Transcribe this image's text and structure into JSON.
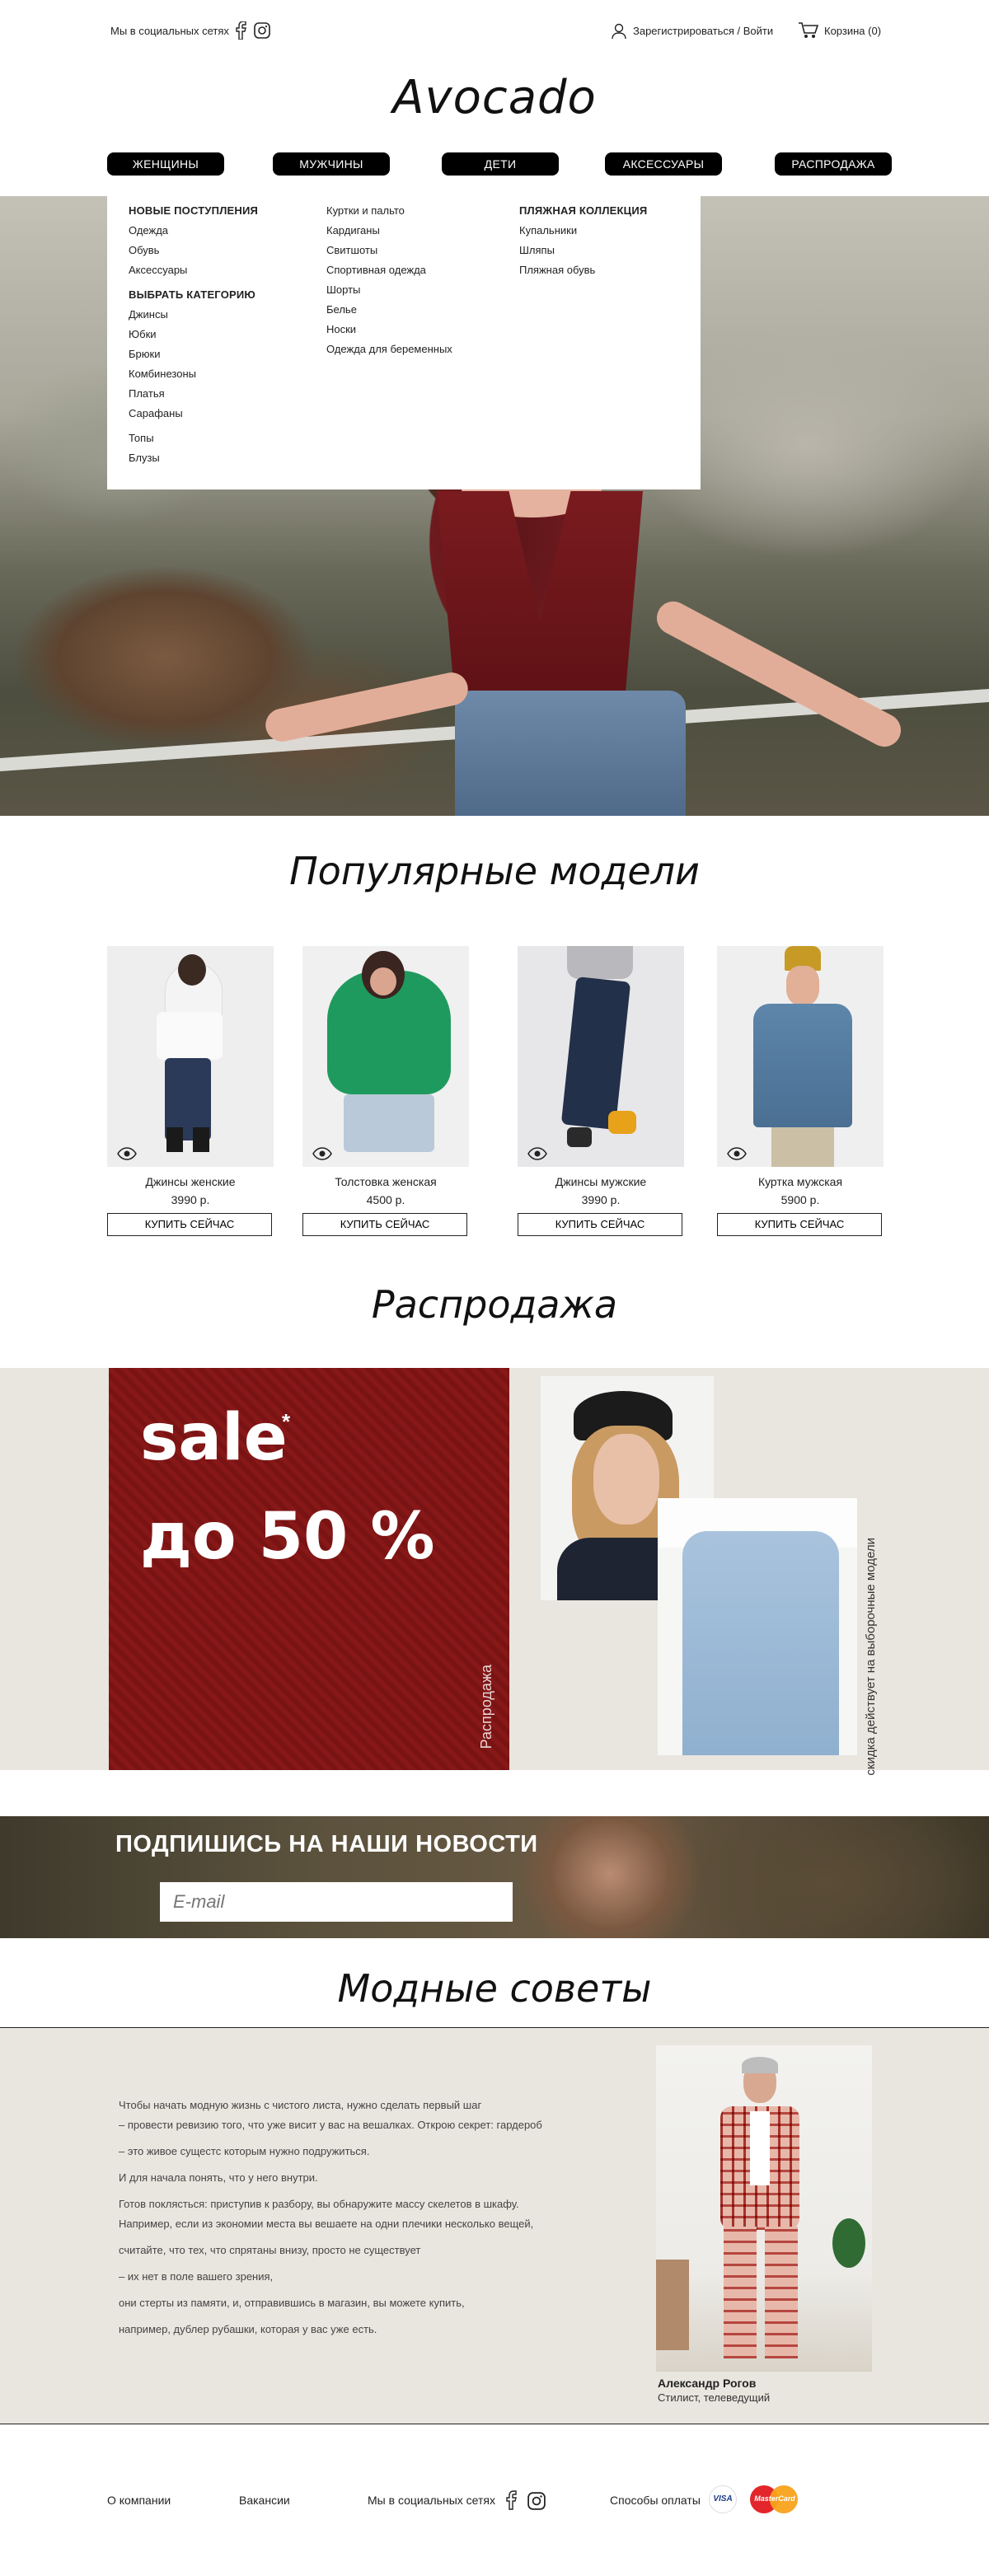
{
  "header": {
    "social_label": "Мы в социальных сетях",
    "login_label": "Зарегистрироваться / Войти",
    "cart_label": "Корзина (0)",
    "logo": "Avocado"
  },
  "nav": [
    "ЖЕНЩИНЫ",
    "МУЖЧИНЫ",
    "ДЕТИ",
    "АКСЕССУАРЫ",
    "РАСПРОДАЖА"
  ],
  "dropdown": {
    "col1_head": "НОВЫЕ ПОСТУПЛЕНИЯ",
    "col1_items": [
      "Одежда",
      "Обувь",
      "Аксессуары"
    ],
    "col1_head2": "ВЫБРАТЬ КАТЕГОРИЮ",
    "col1_items2": [
      "Джинсы",
      "Юбки",
      "Брюки",
      "Комбинезоны",
      "Платья",
      "Сарафаны",
      "Топы",
      "Блузы"
    ],
    "col2_items": [
      "Куртки и пальто",
      "Кардиганы",
      "Свитшоты",
      "Спортивная одежда",
      "Шорты",
      "Белье",
      "Носки",
      "Одежда для беременных"
    ],
    "col3_head": "ПЛЯЖНАЯ КОЛЛЕКЦИЯ",
    "col3_items": [
      "Купальники",
      "Шляпы",
      "Пляжная обувь"
    ]
  },
  "popular": {
    "title": "Популярные модели",
    "buy_label": "КУПИТЬ СЕЙЧАС",
    "items": [
      {
        "name": "Джинсы женские",
        "price": "3990 р."
      },
      {
        "name": "Толстовка женская",
        "price": "4500 р."
      },
      {
        "name": "Джинсы мужские",
        "price": "3990 р."
      },
      {
        "name": "Куртка мужская",
        "price": "5900 р."
      }
    ]
  },
  "sale": {
    "title": "Распродажа",
    "word": "sale",
    "asterisk": "*",
    "discount": "до 50 %",
    "vertical_label": "Распродажа",
    "note": "скидка действует на выборочные модели"
  },
  "newsletter": {
    "title": "ПОДПИШИСЬ НА НАШИ НОВОСТИ",
    "placeholder": "E-mail"
  },
  "tips": {
    "title": "Модные советы",
    "lines": [
      "Чтобы начать модную жизнь  с чистого листа, нужно сделать первый шаг",
      "– провести ревизию того, что уже висит у вас на вешалках. Открою секрет: гардероб",
      "– это живое сущестс которым нужно подружиться.",
      "И для начала понять, что у него внутри.",
      " Готов поклясться: приступив к разбору, вы обнаружите массу скелетов в шкафу.",
      "Например, если из экономии места вы вешаете на одни плечики несколько вещей,",
      "считайте, что тех, что спрятаны внизу, просто не существует",
      " – их нет в поле вашего зрения,",
      "они стерты из памяти, и, отправившись в магазин, вы можете купить,",
      "например, дублер рубашки, которая у вас уже есть."
    ],
    "author_name": "Александр Рогов",
    "author_role": "Стилист, телеведущий"
  },
  "footer": {
    "about": "О компании",
    "jobs": "Вакансии",
    "social": "Мы в социальных сетях",
    "payment": "Способы оплаты",
    "visa": "VISA",
    "mastercard": "MasterCard"
  },
  "colors": {
    "sale_red": "#7c1414",
    "band": "#e9e6df",
    "nav_bg": "#000000"
  }
}
